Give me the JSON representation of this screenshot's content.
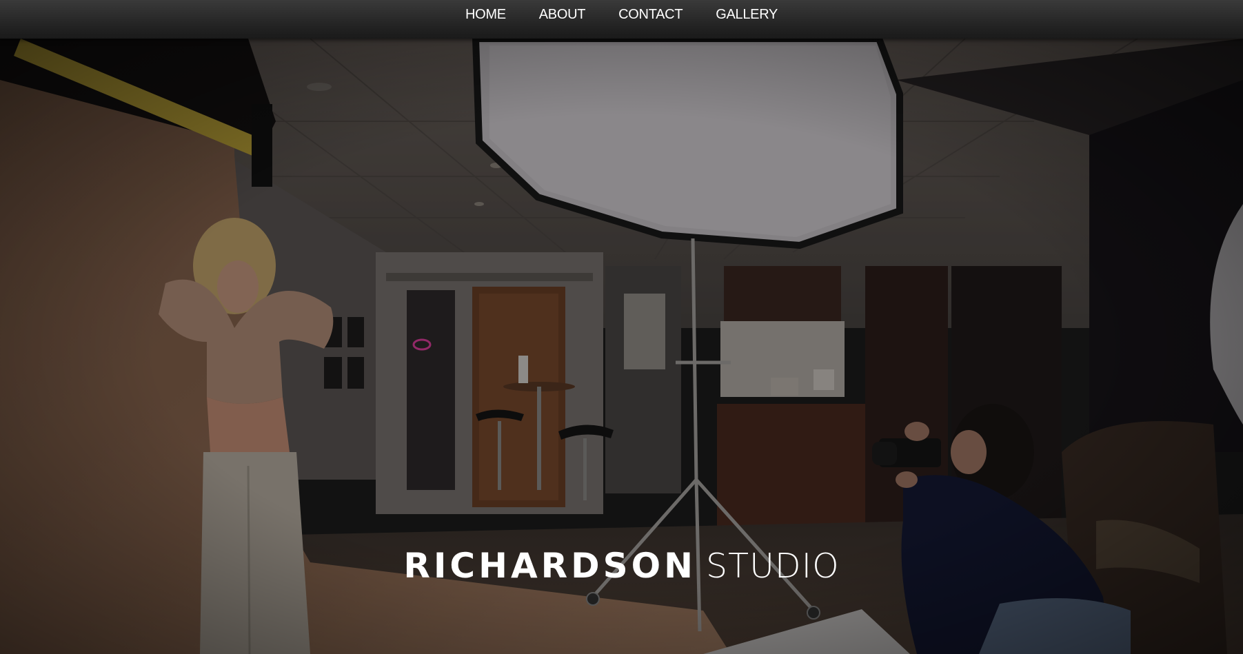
{
  "nav": {
    "items": [
      {
        "label": "HOME"
      },
      {
        "label": "ABOUT"
      },
      {
        "label": "CONTACT"
      },
      {
        "label": "GALLERY"
      }
    ]
  },
  "hero": {
    "brand_main": "RICHARDSON",
    "brand_sub": "STUDIO",
    "image_subject": "photographer shooting a model in a photo studio with octagonal softbox"
  },
  "colors": {
    "nav_bg": "#262626",
    "nav_text": "#ffffff",
    "hero_overlay": "#000000",
    "backdrop_tan": "#a57c5f"
  }
}
